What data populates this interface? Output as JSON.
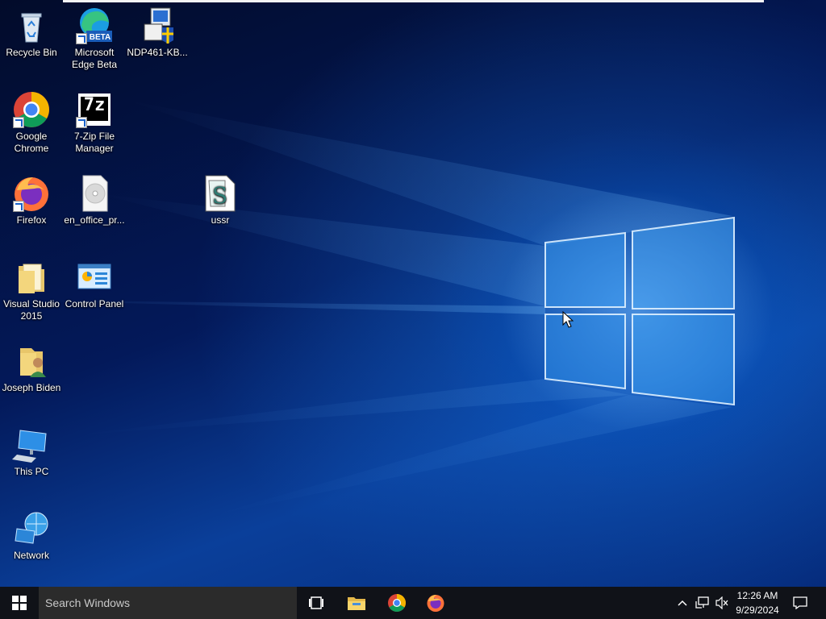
{
  "desktop": {
    "icons": [
      {
        "label": "Recycle Bin",
        "icon": "recycle-bin-icon"
      },
      {
        "label": "Microsoft Edge Beta",
        "icon": "edge-beta-icon",
        "badge": "BETA"
      },
      {
        "label": "NDP461-KB...",
        "icon": "installer-icon"
      },
      {
        "label": "Google Chrome",
        "icon": "chrome-icon"
      },
      {
        "label": "7-Zip File Manager",
        "icon": "7zip-icon",
        "badge": "7z"
      },
      {
        "label": "Firefox",
        "icon": "firefox-icon"
      },
      {
        "label": "en_office_pr...",
        "icon": "disc-image-icon"
      },
      {
        "label": "ussr",
        "icon": "script-file-icon"
      },
      {
        "label": "Visual Studio 2015",
        "icon": "folder-icon"
      },
      {
        "label": "Control Panel",
        "icon": "control-panel-icon"
      },
      {
        "label": "Joseph Biden",
        "icon": "user-folder-icon"
      },
      {
        "label": "This PC",
        "icon": "computer-icon"
      },
      {
        "label": "Network",
        "icon": "network-icon"
      }
    ]
  },
  "taskbar": {
    "start_icon": "windows-logo-icon",
    "search_placeholder": "Search Windows",
    "task_view_icon": "task-view-icon",
    "pinned": [
      {
        "name": "File Explorer",
        "icon": "file-explorer-icon"
      },
      {
        "name": "Google Chrome",
        "icon": "chrome-icon"
      },
      {
        "name": "Firefox",
        "icon": "firefox-icon"
      }
    ],
    "tray_icons": [
      "chevron-up-icon",
      "network-icon",
      "volume-muted-icon"
    ],
    "time": "12:26 AM",
    "date": "9/29/2024",
    "notification_icon": "action-center-icon"
  },
  "colors": {
    "taskbar": "#101218",
    "search_box": "#2b2b2b",
    "wallpaper_dark": "#03195a",
    "wallpaper_light": "#6fc3ff"
  }
}
